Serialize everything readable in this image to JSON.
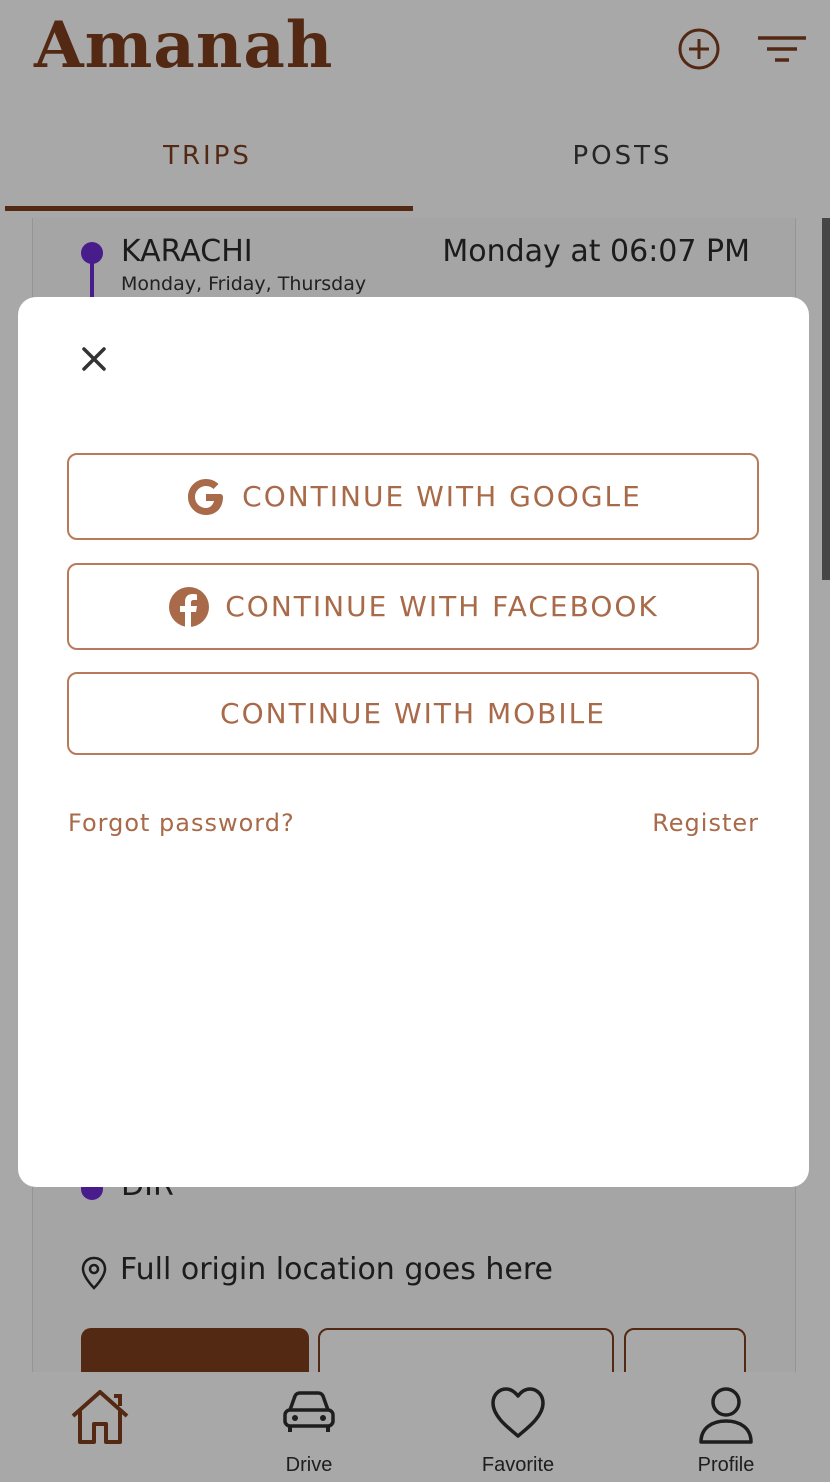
{
  "app": {
    "title": "Amanah"
  },
  "header": {
    "add_icon": "plus-circle-icon",
    "filter_icon": "filter-icon"
  },
  "tabs": [
    {
      "label": "TRIPS",
      "active": true
    },
    {
      "label": "POSTS",
      "active": false
    }
  ],
  "trip": {
    "origin_city": "KARACHI",
    "origin_days": "Monday, Friday, Thursday",
    "time": "Monday at 06:07 PM",
    "destination_city": "DIR",
    "location": "Full origin location goes here",
    "route_color": "#6f2bd4"
  },
  "modal": {
    "close_icon": "close-icon",
    "buttons": [
      {
        "label": "CONTINUE WITH GOOGLE",
        "icon": "google-icon"
      },
      {
        "label": "CONTINUE WITH FACEBOOK",
        "icon": "facebook-icon"
      },
      {
        "label": "CONTINUE WITH MOBILE",
        "icon": ""
      }
    ],
    "forgot_password": "Forgot password?",
    "register": "Register"
  },
  "bottom_nav": [
    {
      "label": "",
      "icon": "home-icon",
      "active": true
    },
    {
      "label": "Drive",
      "icon": "car-icon",
      "active": false
    },
    {
      "label": "Favorite",
      "icon": "heart-icon",
      "active": false
    },
    {
      "label": "Profile",
      "icon": "user-icon",
      "active": false
    }
  ],
  "colors": {
    "brand": "#7f3f1f",
    "accent_light": "#a86a48",
    "route": "#6f2bd4"
  }
}
